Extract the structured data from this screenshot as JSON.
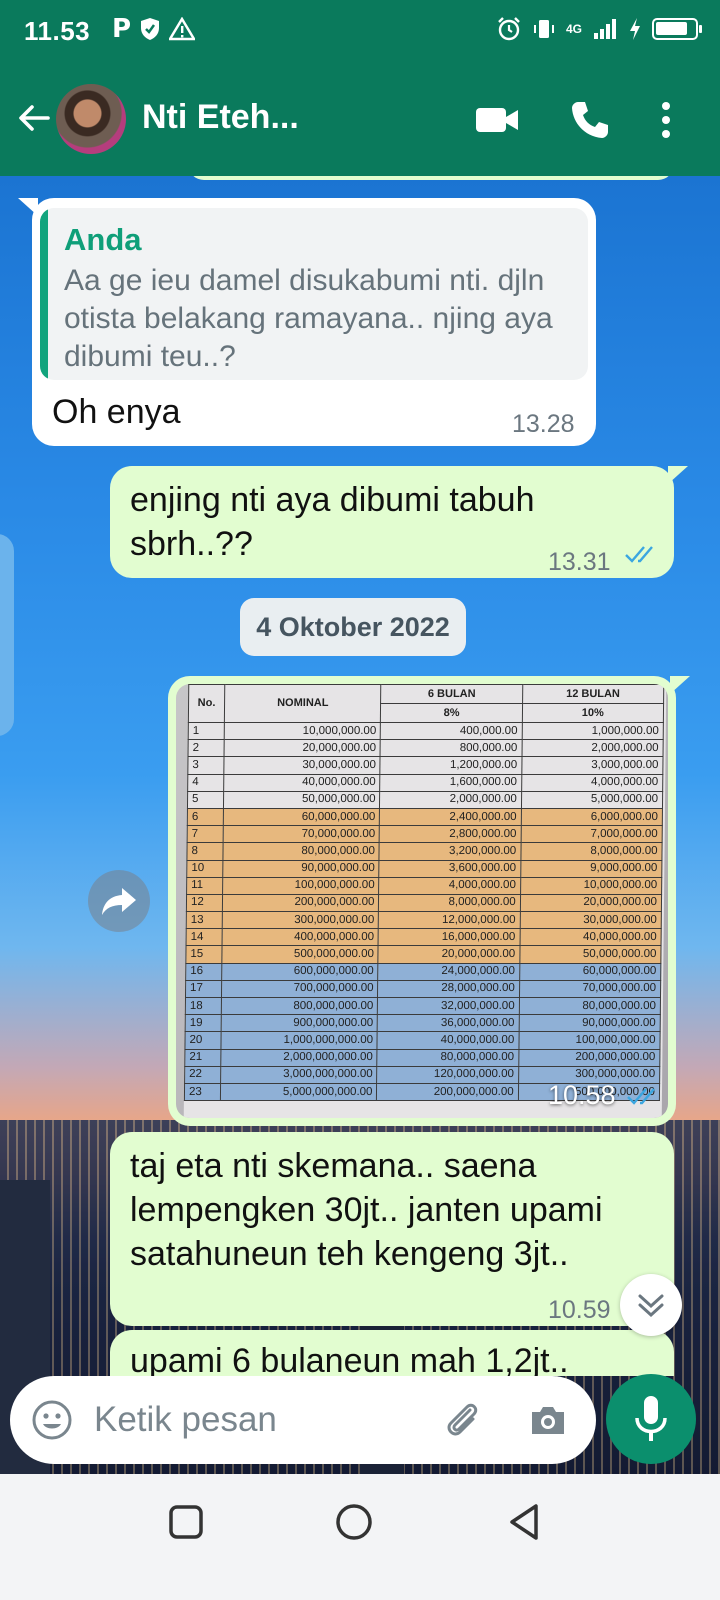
{
  "status_bar": {
    "time": "11.53",
    "network": "4G",
    "battery_level": 0.85
  },
  "header": {
    "contact_name": "Nti Eteh...",
    "icons": [
      "back-arrow-icon",
      "video-call-icon",
      "phone-icon",
      "more-vert-icon"
    ]
  },
  "messages": {
    "reply": {
      "quote_author": "Anda",
      "quote_text": "Aa ge ieu damel disukabumi nti. djln otista belakang ramayana.. njing aya dibumi teu..?",
      "text": "Oh enya",
      "time": "13.28"
    },
    "sent1": {
      "text": "enjing nti aya dibumi tabuh sbrh..??",
      "time": "13.31"
    },
    "date_divider": "4 Oktober 2022",
    "image_msg": {
      "time": "10.58",
      "table": {
        "headers": {
          "no": "No.",
          "nominal": "NOMINAL",
          "col6": "6 BULAN",
          "col12": "12 BULAN",
          "rate6": "8%",
          "rate12": "10%"
        },
        "rows": [
          [
            "1",
            "10,000,000.00",
            "400,000.00",
            "1,000,000.00"
          ],
          [
            "2",
            "20,000,000.00",
            "800,000.00",
            "2,000,000.00"
          ],
          [
            "3",
            "30,000,000.00",
            "1,200,000.00",
            "3,000,000.00"
          ],
          [
            "4",
            "40,000,000.00",
            "1,600,000.00",
            "4,000,000.00"
          ],
          [
            "5",
            "50,000,000.00",
            "2,000,000.00",
            "5,000,000.00"
          ],
          [
            "6",
            "60,000,000.00",
            "2,400,000.00",
            "6,000,000.00"
          ],
          [
            "7",
            "70,000,000.00",
            "2,800,000.00",
            "7,000,000.00"
          ],
          [
            "8",
            "80,000,000.00",
            "3,200,000.00",
            "8,000,000.00"
          ],
          [
            "10",
            "90,000,000.00",
            "3,600,000.00",
            "9,000,000.00"
          ],
          [
            "11",
            "100,000,000.00",
            "4,000,000.00",
            "10,000,000.00"
          ],
          [
            "12",
            "200,000,000.00",
            "8,000,000.00",
            "20,000,000.00"
          ],
          [
            "13",
            "300,000,000.00",
            "12,000,000.00",
            "30,000,000.00"
          ],
          [
            "14",
            "400,000,000.00",
            "16,000,000.00",
            "40,000,000.00"
          ],
          [
            "15",
            "500,000,000.00",
            "20,000,000.00",
            "50,000,000.00"
          ],
          [
            "16",
            "600,000,000.00",
            "24,000,000.00",
            "60,000,000.00"
          ],
          [
            "17",
            "700,000,000.00",
            "28,000,000.00",
            "70,000,000.00"
          ],
          [
            "18",
            "800,000,000.00",
            "32,000,000.00",
            "80,000,000.00"
          ],
          [
            "19",
            "900,000,000.00",
            "36,000,000.00",
            "90,000,000.00"
          ],
          [
            "20",
            "1,000,000,000.00",
            "40,000,000.00",
            "100,000,000.00"
          ],
          [
            "21",
            "2,000,000,000.00",
            "80,000,000.00",
            "200,000,000.00"
          ],
          [
            "22",
            "3,000,000,000.00",
            "120,000,000.00",
            "300,000,000.00"
          ],
          [
            "23",
            "5,000,000,000.00",
            "200,000,000.00",
            "500,000,000.00"
          ]
        ]
      }
    },
    "sent2": {
      "text": "taj eta nti skemana.. saena lempengken 30jt.. janten upami satahuneun teh kengeng 3jt..",
      "time": "10.59"
    },
    "sent3_partial": "upami 6 bulaneun mah 1,2jt.."
  },
  "composer": {
    "placeholder": "Ketik pesan"
  },
  "colors": {
    "header": "#0a7a5c",
    "outgoing_bubble": "#e2fdd0",
    "incoming_bubble": "#ffffff",
    "read_ticks": "#3ba6e0",
    "accent": "#0b8f6d"
  }
}
